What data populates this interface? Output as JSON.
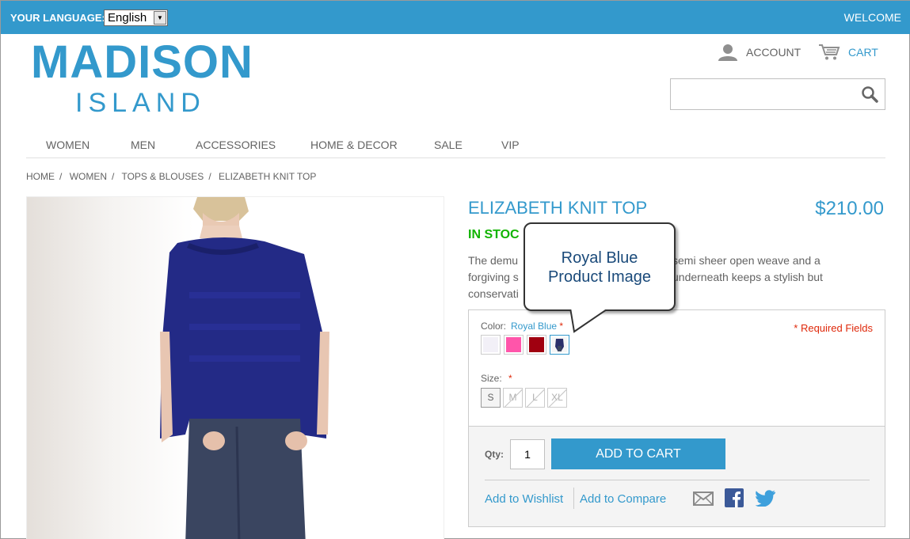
{
  "header": {
    "language_label": "YOUR LANGUAGE:",
    "language_value": "English",
    "welcome": "WELCOME",
    "logo_main": "MADISON",
    "logo_sub": "ISLAND",
    "account": "ACCOUNT",
    "cart": "CART",
    "search_value": ""
  },
  "nav": {
    "items": [
      "WOMEN",
      "MEN",
      "ACCESSORIES",
      "HOME & DECOR",
      "SALE",
      "VIP"
    ]
  },
  "breadcrumb": [
    "HOME",
    "WOMEN",
    "TOPS & BLOUSES",
    "ELIZABETH KNIT TOP"
  ],
  "product": {
    "name": "ELIZABETH KNIT TOP",
    "price": "$210.00",
    "stock": "IN STOC",
    "desc_line1": "The demu",
    "desc_line1b": "semi sheer open weave and a",
    "desc_line2": "forgiving s",
    "desc_line2b": "underneath keeps a stylish but",
    "desc_line3": "conservati"
  },
  "options": {
    "color_label": "Color:",
    "color_value": "Royal Blue",
    "required_star": "*",
    "required_fields": "* Required Fields",
    "swatches": [
      {
        "name": "white",
        "color": "#f2f0f7"
      },
      {
        "name": "pink",
        "color": "#ff55aa"
      },
      {
        "name": "red",
        "color": "#a00010"
      },
      {
        "name": "royal-blue",
        "color": "#2a2f6a"
      }
    ],
    "size_label": "Size:",
    "sizes": [
      "S",
      "M",
      "L",
      "XL"
    ]
  },
  "cart_box": {
    "qty_label": "Qty:",
    "qty_value": "1",
    "add_to_cart": "ADD TO CART",
    "wishlist": "Add to Wishlist",
    "compare": "Add to Compare"
  },
  "callout": {
    "line1": "Royal Blue",
    "line2": "Product Image"
  },
  "colors": {
    "accent": "#3399cc",
    "in_stock": "#11b400",
    "required": "#df280a"
  }
}
